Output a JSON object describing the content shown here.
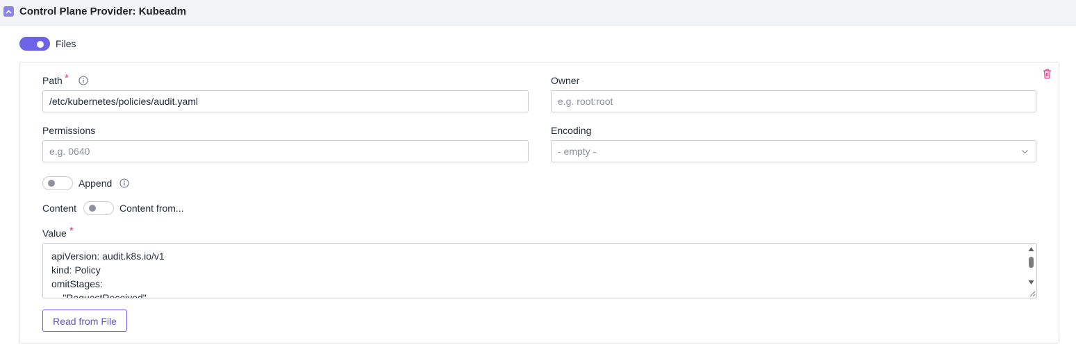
{
  "section": {
    "title": "Control Plane Provider: Kubeadm"
  },
  "files_toggle": {
    "label": "Files",
    "on": true
  },
  "form": {
    "path": {
      "label": "Path",
      "required_mark": "*",
      "value": "/etc/kubernetes/policies/audit.yaml"
    },
    "owner": {
      "label": "Owner",
      "placeholder": "e.g. root:root"
    },
    "permissions": {
      "label": "Permissions",
      "placeholder": "e.g. 0640"
    },
    "encoding": {
      "label": "Encoding",
      "selected": "- empty -"
    },
    "append": {
      "label": "Append",
      "on": false
    },
    "content_switch": {
      "left_label": "Content",
      "right_label": "Content from...",
      "on": false
    },
    "value": {
      "label": "Value",
      "required_mark": "*",
      "lines": [
        "apiVersion: audit.k8s.io/v1",
        "kind: Policy",
        "omitStages:",
        "  - \"RequestReceived\""
      ]
    },
    "read_button": "Read from File"
  },
  "colors": {
    "accent": "#6c63e6",
    "required": "#d63384",
    "delete": "#e0408a"
  },
  "icons": [
    "chevron-up-icon",
    "info-icon",
    "trash-icon",
    "chevron-down-icon"
  ]
}
